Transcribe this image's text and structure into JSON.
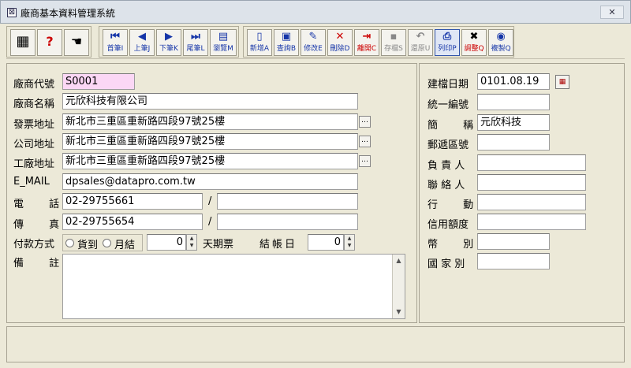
{
  "window": {
    "title": "廠商基本資料管理系統",
    "close_label": "✕"
  },
  "toolbar": {
    "nav": {
      "first": "首筆I",
      "prev": "上筆J",
      "next": "下筆K",
      "last": "尾筆L",
      "browse": "瀏覽M"
    },
    "actions": {
      "add": "新增A",
      "query": "查詢B",
      "edit": "修改E",
      "delete": "刪除D",
      "exit": "離開C",
      "save": "存檔S",
      "restore": "還原U",
      "print": "列印P",
      "adjust": "調整Q",
      "copy": "複製Q"
    }
  },
  "form": {
    "vendor_code": {
      "label": "廠商代號",
      "value": "S0001"
    },
    "vendor_name": {
      "label": "廠商名稱",
      "value": "元欣科技有限公司"
    },
    "invoice_address": {
      "label": "發票地址",
      "value": "新北市三重區重新路四段97號25樓"
    },
    "company_address": {
      "label": "公司地址",
      "value": "新北市三重區重新路四段97號25樓"
    },
    "factory_address": {
      "label": "工廠地址",
      "value": "新北市三重區重新路四段97號25樓"
    },
    "email": {
      "label": "E_MAIL",
      "value": "dpsales@datapro.com.tw"
    },
    "phone": {
      "label": "電 話",
      "value": "02-29755661",
      "extra": ""
    },
    "fax": {
      "label": "傳 真",
      "value": "02-29755654",
      "extra": ""
    },
    "payment": {
      "label": "付款方式",
      "opt1": "貨到",
      "opt2": "月結",
      "days": "0",
      "days_label": "天期票",
      "closing_label": "結帳日",
      "closing_day": "0"
    },
    "remark": {
      "label": "備 註",
      "value": ""
    }
  },
  "right": {
    "created_date": {
      "label": "建檔日期",
      "value": "0101.08.19"
    },
    "tax_id": {
      "label": "統一編號",
      "value": ""
    },
    "short_name": {
      "label": "簡 稱",
      "value": "元欣科技"
    },
    "postal_code": {
      "label": "郵遞區號",
      "value": ""
    },
    "owner": {
      "label": "負 責 人",
      "value": ""
    },
    "contact": {
      "label": "聯 絡 人",
      "value": ""
    },
    "mobile": {
      "label": "行 動",
      "value": ""
    },
    "credit": {
      "label": "信用額度",
      "value": ""
    },
    "currency": {
      "label": "幣 別",
      "value": ""
    },
    "country": {
      "label": "國 家 別",
      "value": ""
    }
  }
}
